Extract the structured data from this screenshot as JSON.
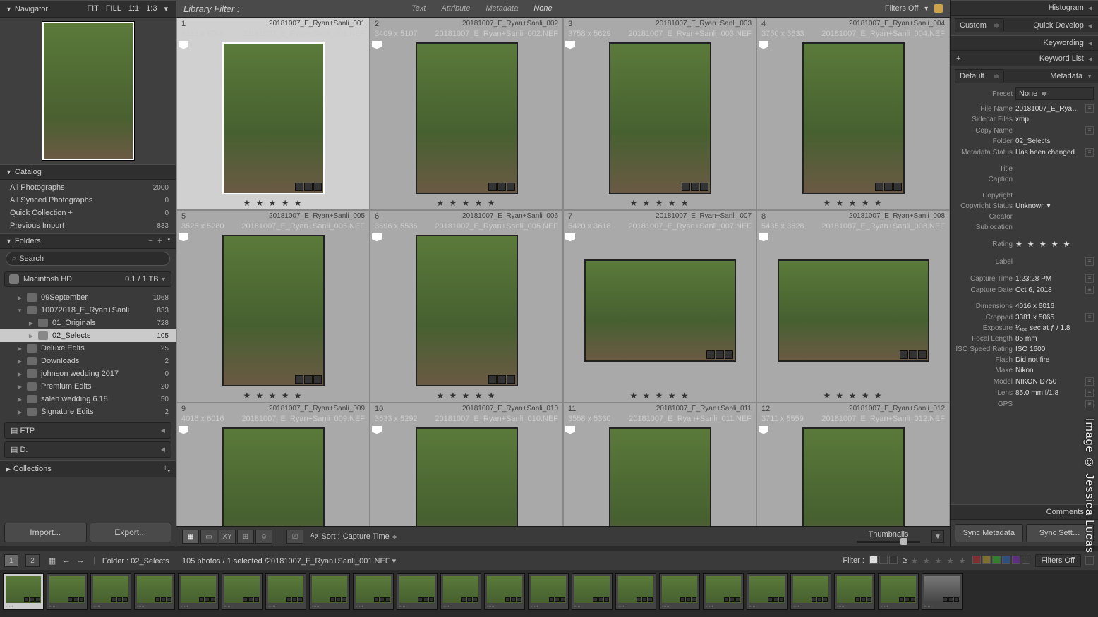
{
  "navigator": {
    "title": "Navigator",
    "zoom": [
      "FIT",
      "FILL",
      "1:1",
      "1:3"
    ]
  },
  "catalog": {
    "title": "Catalog",
    "items": [
      {
        "label": "All Photographs",
        "count": "2000"
      },
      {
        "label": "All Synced Photographs",
        "count": "0"
      },
      {
        "label": "Quick Collection  +",
        "count": "0"
      },
      {
        "label": "Previous Import",
        "count": "833"
      }
    ]
  },
  "folders": {
    "title": "Folders",
    "search": "Search",
    "volume": {
      "name": "Macintosh HD",
      "capacity": "0.1 / 1 TB"
    },
    "tree": [
      {
        "depth": 1,
        "arrow": "▶",
        "name": "09September",
        "count": "1068"
      },
      {
        "depth": 1,
        "arrow": "▼",
        "name": "10072018_E_Ryan+Sanli",
        "count": "833"
      },
      {
        "depth": 2,
        "arrow": "▶",
        "name": "01_Originals",
        "count": "728"
      },
      {
        "depth": 2,
        "arrow": "▶",
        "name": "02_Selects",
        "count": "105",
        "selected": true
      },
      {
        "depth": 1,
        "arrow": "▶",
        "name": "Deluxe Edits",
        "count": "25"
      },
      {
        "depth": 1,
        "arrow": "▶",
        "name": "Downloads",
        "count": "2"
      },
      {
        "depth": 1,
        "arrow": "▶",
        "name": "johnson wedding 2017",
        "count": "0"
      },
      {
        "depth": 1,
        "arrow": "▶",
        "name": "Premium Edits",
        "count": "20"
      },
      {
        "depth": 1,
        "arrow": "▶",
        "name": "saleh wedding 6.18",
        "count": "50"
      },
      {
        "depth": 1,
        "arrow": "▶",
        "name": "Signature Edits",
        "count": "2"
      }
    ],
    "drives": [
      "FTP",
      "D:"
    ]
  },
  "collections": {
    "title": "Collections"
  },
  "buttons": {
    "import": "Import...",
    "export": "Export..."
  },
  "libFilter": {
    "title": "Library Filter :",
    "tabs": [
      "Text",
      "Attribute",
      "Metadata",
      "None"
    ],
    "filters_off": "Filters Off"
  },
  "grid": [
    {
      "idx": "1",
      "name": "20181007_E_Ryan+Sanli_001",
      "dim": "3381 x 5065",
      "nef": "20181007_E_Ryan+Sanli_001.NEF",
      "orient": "portrait",
      "sel": true
    },
    {
      "idx": "2",
      "name": "20181007_E_Ryan+Sanli_002",
      "dim": "3409 x 5107",
      "nef": "20181007_E_Ryan+Sanli_002.NEF",
      "orient": "portrait"
    },
    {
      "idx": "3",
      "name": "20181007_E_Ryan+Sanli_003",
      "dim": "3758 x 5629",
      "nef": "20181007_E_Ryan+Sanli_003.NEF",
      "orient": "portrait"
    },
    {
      "idx": "4",
      "name": "20181007_E_Ryan+Sanli_004",
      "dim": "3760 x 5633",
      "nef": "20181007_E_Ryan+Sanli_004.NEF",
      "orient": "portrait"
    },
    {
      "idx": "5",
      "name": "20181007_E_Ryan+Sanli_005",
      "dim": "3525 x 5280",
      "nef": "20181007_E_Ryan+Sanli_005.NEF",
      "orient": "portrait"
    },
    {
      "idx": "6",
      "name": "20181007_E_Ryan+Sanli_006",
      "dim": "3696 x 5536",
      "nef": "20181007_E_Ryan+Sanli_006.NEF",
      "orient": "portrait"
    },
    {
      "idx": "7",
      "name": "20181007_E_Ryan+Sanli_007",
      "dim": "5420 x 3618",
      "nef": "20181007_E_Ryan+Sanli_007.NEF",
      "orient": "landscape"
    },
    {
      "idx": "8",
      "name": "20181007_E_Ryan+Sanli_008",
      "dim": "5435 x 3628",
      "nef": "20181007_E_Ryan+Sanli_008.NEF",
      "orient": "landscape"
    },
    {
      "idx": "9",
      "name": "20181007_E_Ryan+Sanli_009",
      "dim": "4016 x 6016",
      "nef": "20181007_E_Ryan+Sanli_009.NEF",
      "orient": "portrait"
    },
    {
      "idx": "10",
      "name": "20181007_E_Ryan+Sanli_010",
      "dim": "3533 x 5292",
      "nef": "20181007_E_Ryan+Sanli_010.NEF",
      "orient": "portrait"
    },
    {
      "idx": "11",
      "name": "20181007_E_Ryan+Sanli_011",
      "dim": "3558 x 5330",
      "nef": "20181007_E_Ryan+Sanli_011.NEF",
      "orient": "portrait"
    },
    {
      "idx": "12",
      "name": "20181007_E_Ryan+Sanli_012",
      "dim": "3711 x 5559",
      "nef": "20181007_E_Ryan+Sanli_012.NEF",
      "orient": "portrait"
    }
  ],
  "stars": "★ ★ ★ ★ ★",
  "toolbar": {
    "sort_label": "Sort :",
    "sort_value": "Capture Time",
    "thumbs": "Thumbnails"
  },
  "secondary": {
    "folder_label": "Folder :",
    "folder": "02_Selects",
    "count": "105 photos /",
    "selected": "1 selected",
    "slash": "/",
    "file": "20181007_E_Ryan+Sanli_001.NEF",
    "filter_label": "Filter :",
    "filters_off": "Filters Off"
  },
  "right": {
    "histogram": "Histogram",
    "quick_develop": "Quick Develop",
    "qd_preset": "Custom",
    "keywording": "Keywording",
    "keyword_list": "Keyword List",
    "metadata": "Metadata",
    "md_preset": "Default",
    "comments": "Comments",
    "preset_label": "Preset",
    "preset_value": "None",
    "fields": [
      {
        "lbl": "File Name",
        "val": "20181007_E_Ryan+Sanli_001.NEF",
        "go": true,
        "multiline": true
      },
      {
        "lbl": "Sidecar Files",
        "val": "xmp"
      },
      {
        "lbl": "Copy Name",
        "val": "",
        "go": true
      },
      {
        "lbl": "Folder",
        "val": "02_Selects"
      },
      {
        "lbl": "Metadata Status",
        "val": "Has been changed",
        "go": true
      },
      {
        "spacer": true
      },
      {
        "lbl": "Title",
        "val": ""
      },
      {
        "lbl": "Caption",
        "val": ""
      },
      {
        "spacer": true
      },
      {
        "lbl": "Copyright",
        "val": ""
      },
      {
        "lbl": "Copyright Status",
        "val": "Unknown",
        "dd": true
      },
      {
        "lbl": "Creator",
        "val": ""
      },
      {
        "lbl": "Sublocation",
        "val": ""
      },
      {
        "spacer": true
      },
      {
        "lbl": "Rating",
        "val": "★ ★ ★ ★ ★",
        "stars": true
      },
      {
        "spacer": true
      },
      {
        "lbl": "Label",
        "val": "",
        "go": true
      },
      {
        "spacer": true
      },
      {
        "lbl": "Capture Time",
        "val": "1:23:28 PM",
        "go": true
      },
      {
        "lbl": "Capture Date",
        "val": "Oct 6, 2018",
        "go": true
      },
      {
        "spacer": true
      },
      {
        "lbl": "Dimensions",
        "val": "4016 x 6016"
      },
      {
        "lbl": "Cropped",
        "val": "3381 x 5065",
        "go": true
      },
      {
        "lbl": "Exposure",
        "val": "¹⁄₄₀₀ sec at ƒ / 1.8"
      },
      {
        "lbl": "Focal Length",
        "val": "85 mm"
      },
      {
        "lbl": "ISO Speed Rating",
        "val": "ISO 1600"
      },
      {
        "lbl": "Flash",
        "val": "Did not fire"
      },
      {
        "lbl": "Make",
        "val": "Nikon"
      },
      {
        "lbl": "Model",
        "val": "NIKON D750",
        "go": true
      },
      {
        "lbl": "Lens",
        "val": "85.0 mm f/1.8",
        "go": true
      },
      {
        "lbl": "GPS",
        "val": "",
        "go": true
      }
    ],
    "sync_metadata": "Sync Metadata",
    "sync_settings": "Sync Sett…"
  },
  "watermark": "Image © Jessica Lucas"
}
